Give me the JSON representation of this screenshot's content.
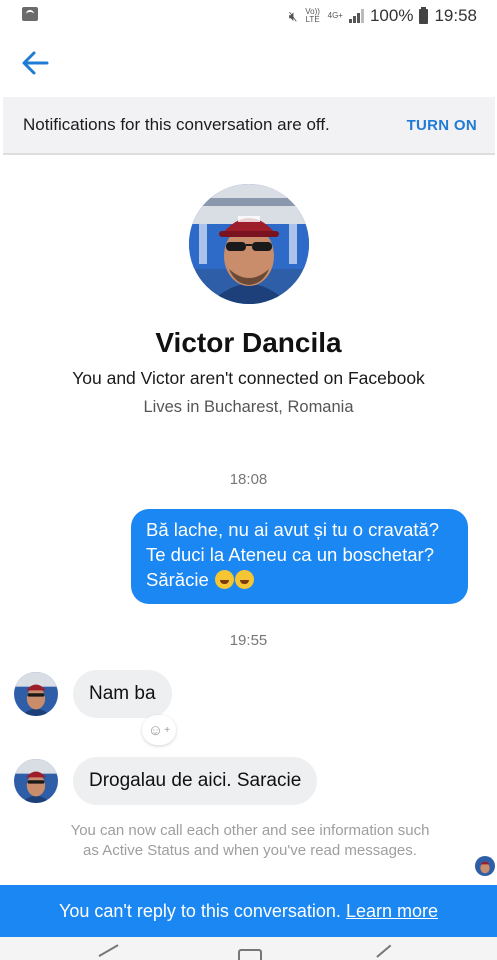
{
  "status_bar": {
    "network_tag_top": "Vo)) LTE",
    "network_tag_4g": "4G+",
    "battery": "100%",
    "time": "19:58",
    "icons": [
      "notification-icon",
      "mute-icon",
      "signal-icon",
      "battery-icon"
    ]
  },
  "app_bar": {
    "back_icon": "back-arrow-icon"
  },
  "notification_banner": {
    "text": "Notifications for this conversation are off.",
    "action": "TURN ON"
  },
  "profile": {
    "name": "Victor Dancila",
    "connection": "You and Victor aren't connected on Facebook",
    "location": "Lives in Bucharest, Romania"
  },
  "messages": [
    {
      "type": "timestamp",
      "text": "18:08"
    },
    {
      "type": "outgoing",
      "text": "Bă lache, nu ai avut și tu o cravată? Te duci la Ateneu ca un boschetar? Sărăcie"
    },
    {
      "type": "timestamp",
      "text": "19:55"
    },
    {
      "type": "incoming",
      "text": "Nam ba"
    },
    {
      "type": "incoming",
      "text": "Drogalau de aici. Saracie"
    }
  ],
  "info": {
    "text": "You can now call each other and see information such as Active Status and when you've read messages."
  },
  "footer": {
    "text": "You can't reply to this conversation.",
    "link": "Learn more"
  },
  "colors": {
    "accent": "#1b87f2",
    "link_blue": "#1f7bd3",
    "incoming_bubble": "#eeeff1",
    "banner_bg": "#f2f2f4"
  }
}
